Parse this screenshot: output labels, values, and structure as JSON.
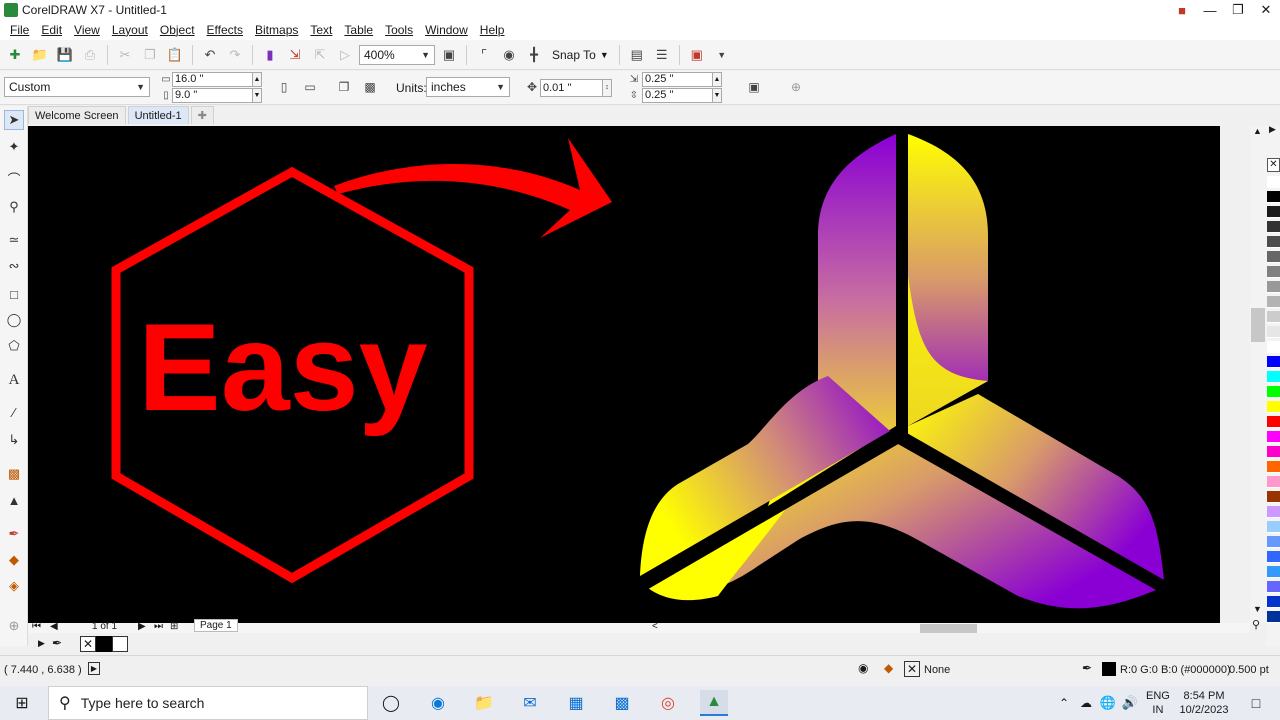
{
  "window": {
    "title": "CorelDRAW X7 - Untitled-1"
  },
  "menu": [
    "File",
    "Edit",
    "View",
    "Layout",
    "Object",
    "Effects",
    "Bitmaps",
    "Text",
    "Table",
    "Tools",
    "Window",
    "Help"
  ],
  "toolbar": {
    "zoom": "400%",
    "snap_to": "Snap To"
  },
  "property_bar": {
    "page_preset": "Custom",
    "page_width": "16.0 \"",
    "page_height": "9.0 \"",
    "units_label": "Units:",
    "units_value": "inches",
    "nudge": "0.01 \"",
    "dup_x": "0.25 \"",
    "dup_y": "0.25 \""
  },
  "tabs": [
    {
      "label": "Welcome Screen"
    },
    {
      "label": "Untitled-1"
    }
  ],
  "canvas": {
    "easy_text": "Easy",
    "easy_color": "#ff0000",
    "bg": "#000000"
  },
  "page_nav": {
    "counter": "1 of 1",
    "page_label": "Page 1"
  },
  "status": {
    "coords": "( 7.440 , 6.638 )",
    "fill_none": "None",
    "outline_color": "R:0 G:0 B:0 (#000000)",
    "outline_width": "0.500 pt"
  },
  "taskbar": {
    "search_placeholder": "Type here to search",
    "lang_top": "ENG",
    "lang_bottom": "IN",
    "time": "8:54 PM",
    "date": "10/2/2023"
  },
  "palette_colors": [
    "#ffffff",
    "#000000",
    "#1a1a1a",
    "#333333",
    "#4d4d4d",
    "#666666",
    "#808080",
    "#999999",
    "#b3b3b3",
    "#cccccc",
    "#e6e6e6",
    "#ffffff",
    "#0000ff",
    "#00ffff",
    "#00ff00",
    "#ffff00",
    "#ff0000",
    "#ff00ff",
    "#ff00cc",
    "#ff6600",
    "#ff99cc",
    "#993300",
    "#cc99ff",
    "#99ccff",
    "#6699ff",
    "#3366ff",
    "#3399ff",
    "#6666ff",
    "#0033cc",
    "#003399"
  ]
}
